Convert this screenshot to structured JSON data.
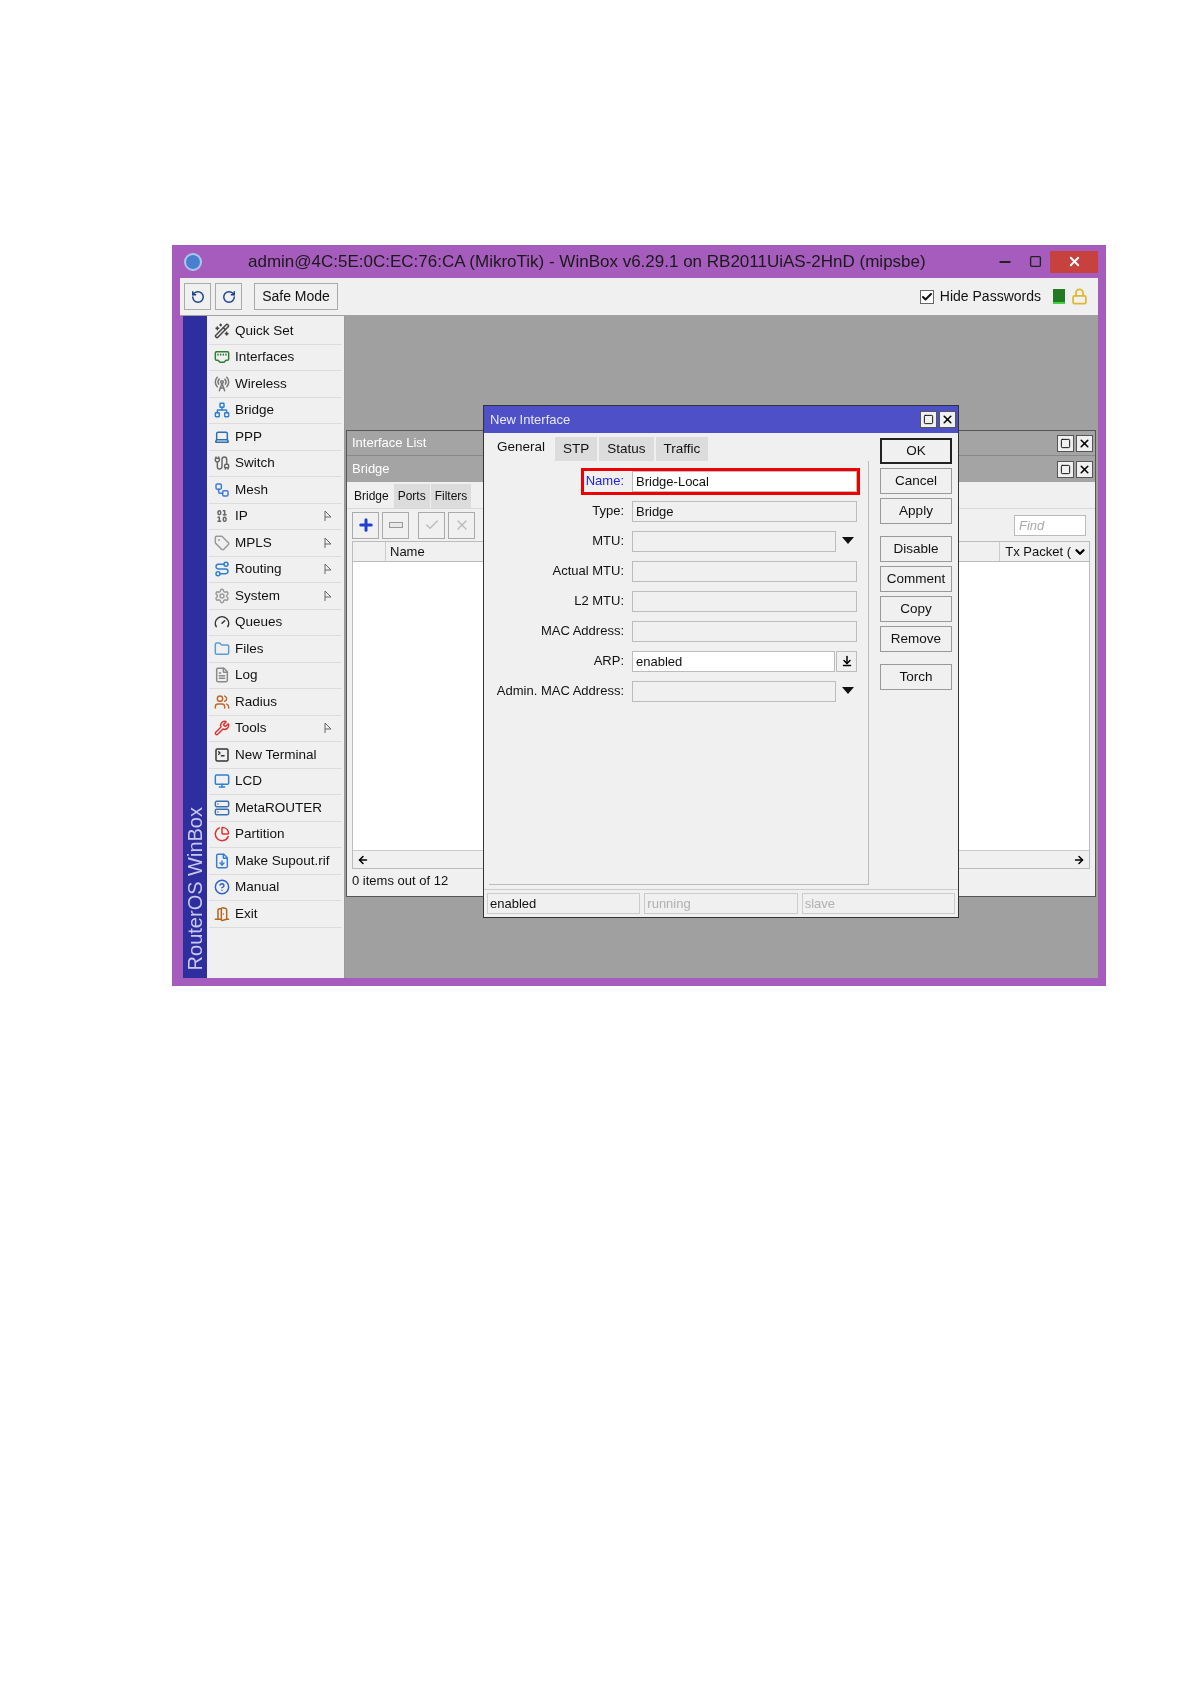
{
  "window": {
    "title": "admin@4C:5E:0C:EC:76:CA (MikroTik) - WinBox v6.29.1 on RB2011UiAS-2HnD (mipsbe)"
  },
  "toolbar": {
    "safe_mode": "Safe Mode",
    "hide_passwords": {
      "label": "Hide Passwords",
      "checked": true
    }
  },
  "sidebar": {
    "brand": "RouterOS WinBox",
    "items": [
      {
        "label": "Quick Set",
        "submenu": false
      },
      {
        "label": "Interfaces",
        "submenu": false
      },
      {
        "label": "Wireless",
        "submenu": false
      },
      {
        "label": "Bridge",
        "submenu": false
      },
      {
        "label": "PPP",
        "submenu": false
      },
      {
        "label": "Switch",
        "submenu": false
      },
      {
        "label": "Mesh",
        "submenu": false
      },
      {
        "label": "IP",
        "submenu": true
      },
      {
        "label": "MPLS",
        "submenu": true
      },
      {
        "label": "Routing",
        "submenu": true
      },
      {
        "label": "System",
        "submenu": true
      },
      {
        "label": "Queues",
        "submenu": false
      },
      {
        "label": "Files",
        "submenu": false
      },
      {
        "label": "Log",
        "submenu": false
      },
      {
        "label": "Radius",
        "submenu": false
      },
      {
        "label": "Tools",
        "submenu": true
      },
      {
        "label": "New Terminal",
        "submenu": false
      },
      {
        "label": "LCD",
        "submenu": false
      },
      {
        "label": "MetaROUTER",
        "submenu": false
      },
      {
        "label": "Partition",
        "submenu": false
      },
      {
        "label": "Make Supout.rif",
        "submenu": false
      },
      {
        "label": "Manual",
        "submenu": false
      },
      {
        "label": "Exit",
        "submenu": false
      }
    ]
  },
  "interface_list": {
    "title": "Interface List",
    "bridge": {
      "title": "Bridge",
      "tabs": [
        {
          "label": "Bridge",
          "selected": true
        },
        {
          "label": "Ports",
          "selected": false
        },
        {
          "label": "Filters",
          "selected": false
        }
      ],
      "search": {
        "placeholder": "Find"
      },
      "columns": [
        "Name",
        "Tx Packet ("
      ],
      "status": "0 items out of 12"
    }
  },
  "dialog": {
    "title": "New Interface",
    "tabs": [
      {
        "label": "General",
        "selected": true
      },
      {
        "label": "STP",
        "selected": false
      },
      {
        "label": "Status",
        "selected": false
      },
      {
        "label": "Traffic",
        "selected": false
      }
    ],
    "fields": [
      {
        "label": "Name:",
        "value": "Bridge-Local",
        "kind": "text",
        "readonly": false,
        "highlighted": true
      },
      {
        "label": "Type:",
        "value": "Bridge",
        "kind": "text",
        "readonly": true,
        "highlighted": false
      },
      {
        "label": "MTU:",
        "kind": "dropdown",
        "readonly": true,
        "highlighted": false
      },
      {
        "label": "Actual MTU:",
        "kind": "text",
        "readonly": true,
        "highlighted": false
      },
      {
        "label": "L2 MTU:",
        "kind": "text",
        "readonly": true,
        "highlighted": false
      },
      {
        "label": "MAC Address:",
        "kind": "text",
        "readonly": true,
        "highlighted": false
      },
      {
        "label": "ARP:",
        "value": "enabled",
        "kind": "combo",
        "readonly": false,
        "highlighted": false
      },
      {
        "label": "Admin. MAC Address:",
        "kind": "dropdown",
        "readonly": true,
        "highlighted": false
      }
    ],
    "buttons": [
      [
        {
          "label": "OK",
          "default": true
        },
        {
          "label": "Cancel",
          "default": false
        },
        {
          "label": "Apply",
          "default": false
        }
      ],
      [
        {
          "label": "Disable",
          "default": false
        },
        {
          "label": "Comment",
          "default": false
        },
        {
          "label": "Copy",
          "default": false
        },
        {
          "label": "Remove",
          "default": false
        }
      ],
      [
        {
          "label": "Torch",
          "default": false
        }
      ]
    ],
    "status_bar": [
      {
        "text": "enabled",
        "disabled": false
      },
      {
        "text": "running",
        "disabled": true
      },
      {
        "text": "slave",
        "disabled": true
      }
    ]
  }
}
